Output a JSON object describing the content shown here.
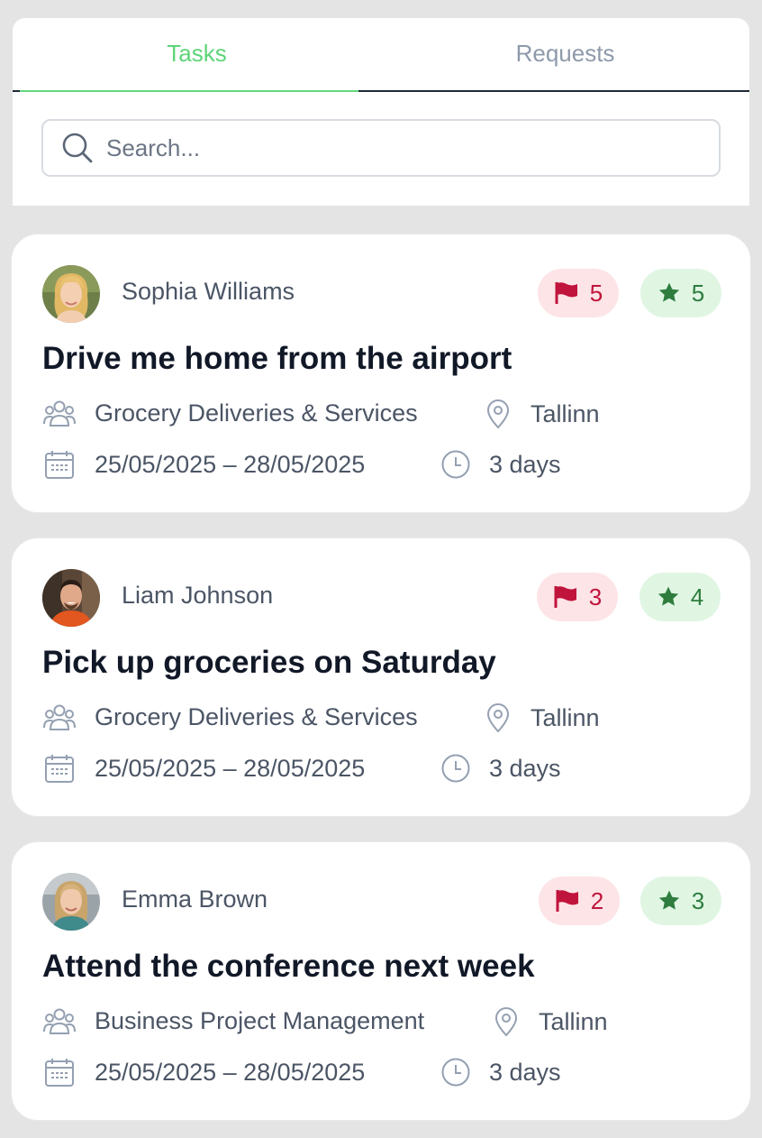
{
  "tabs": [
    {
      "label": "Tasks",
      "active": true
    },
    {
      "label": "Requests",
      "active": false
    }
  ],
  "search": {
    "placeholder": "Search...",
    "value": ""
  },
  "colors": {
    "active_tab": "#5fd47a",
    "flag_badge_bg": "#fde4e6",
    "flag_badge_fg": "#c0143c",
    "star_badge_bg": "#e0f6e3",
    "star_badge_fg": "#2e7d3e"
  },
  "tasks": [
    {
      "author": "Sophia Williams",
      "avatar": "avatar-blonde-woman",
      "flags": "5",
      "stars": "5",
      "title": "Drive me home from the airport",
      "category": "Grocery Deliveries & Services",
      "location": "Tallinn",
      "dates": "25/05/2025 – 28/05/2025",
      "duration": "3 days"
    },
    {
      "author": "Liam Johnson",
      "avatar": "avatar-man-orange-sweater",
      "flags": "3",
      "stars": "4",
      "title": "Pick up groceries on Saturday",
      "category": "Grocery Deliveries & Services",
      "location": "Tallinn",
      "dates": "25/05/2025 – 28/05/2025",
      "duration": "3 days"
    },
    {
      "author": "Emma Brown",
      "avatar": "avatar-woman-light-hair",
      "flags": "2",
      "stars": "3",
      "title": "Attend the conference next week",
      "category": "Business Project Management",
      "location": "Tallinn",
      "dates": "25/05/2025 – 28/05/2025",
      "duration": "3 days"
    }
  ]
}
